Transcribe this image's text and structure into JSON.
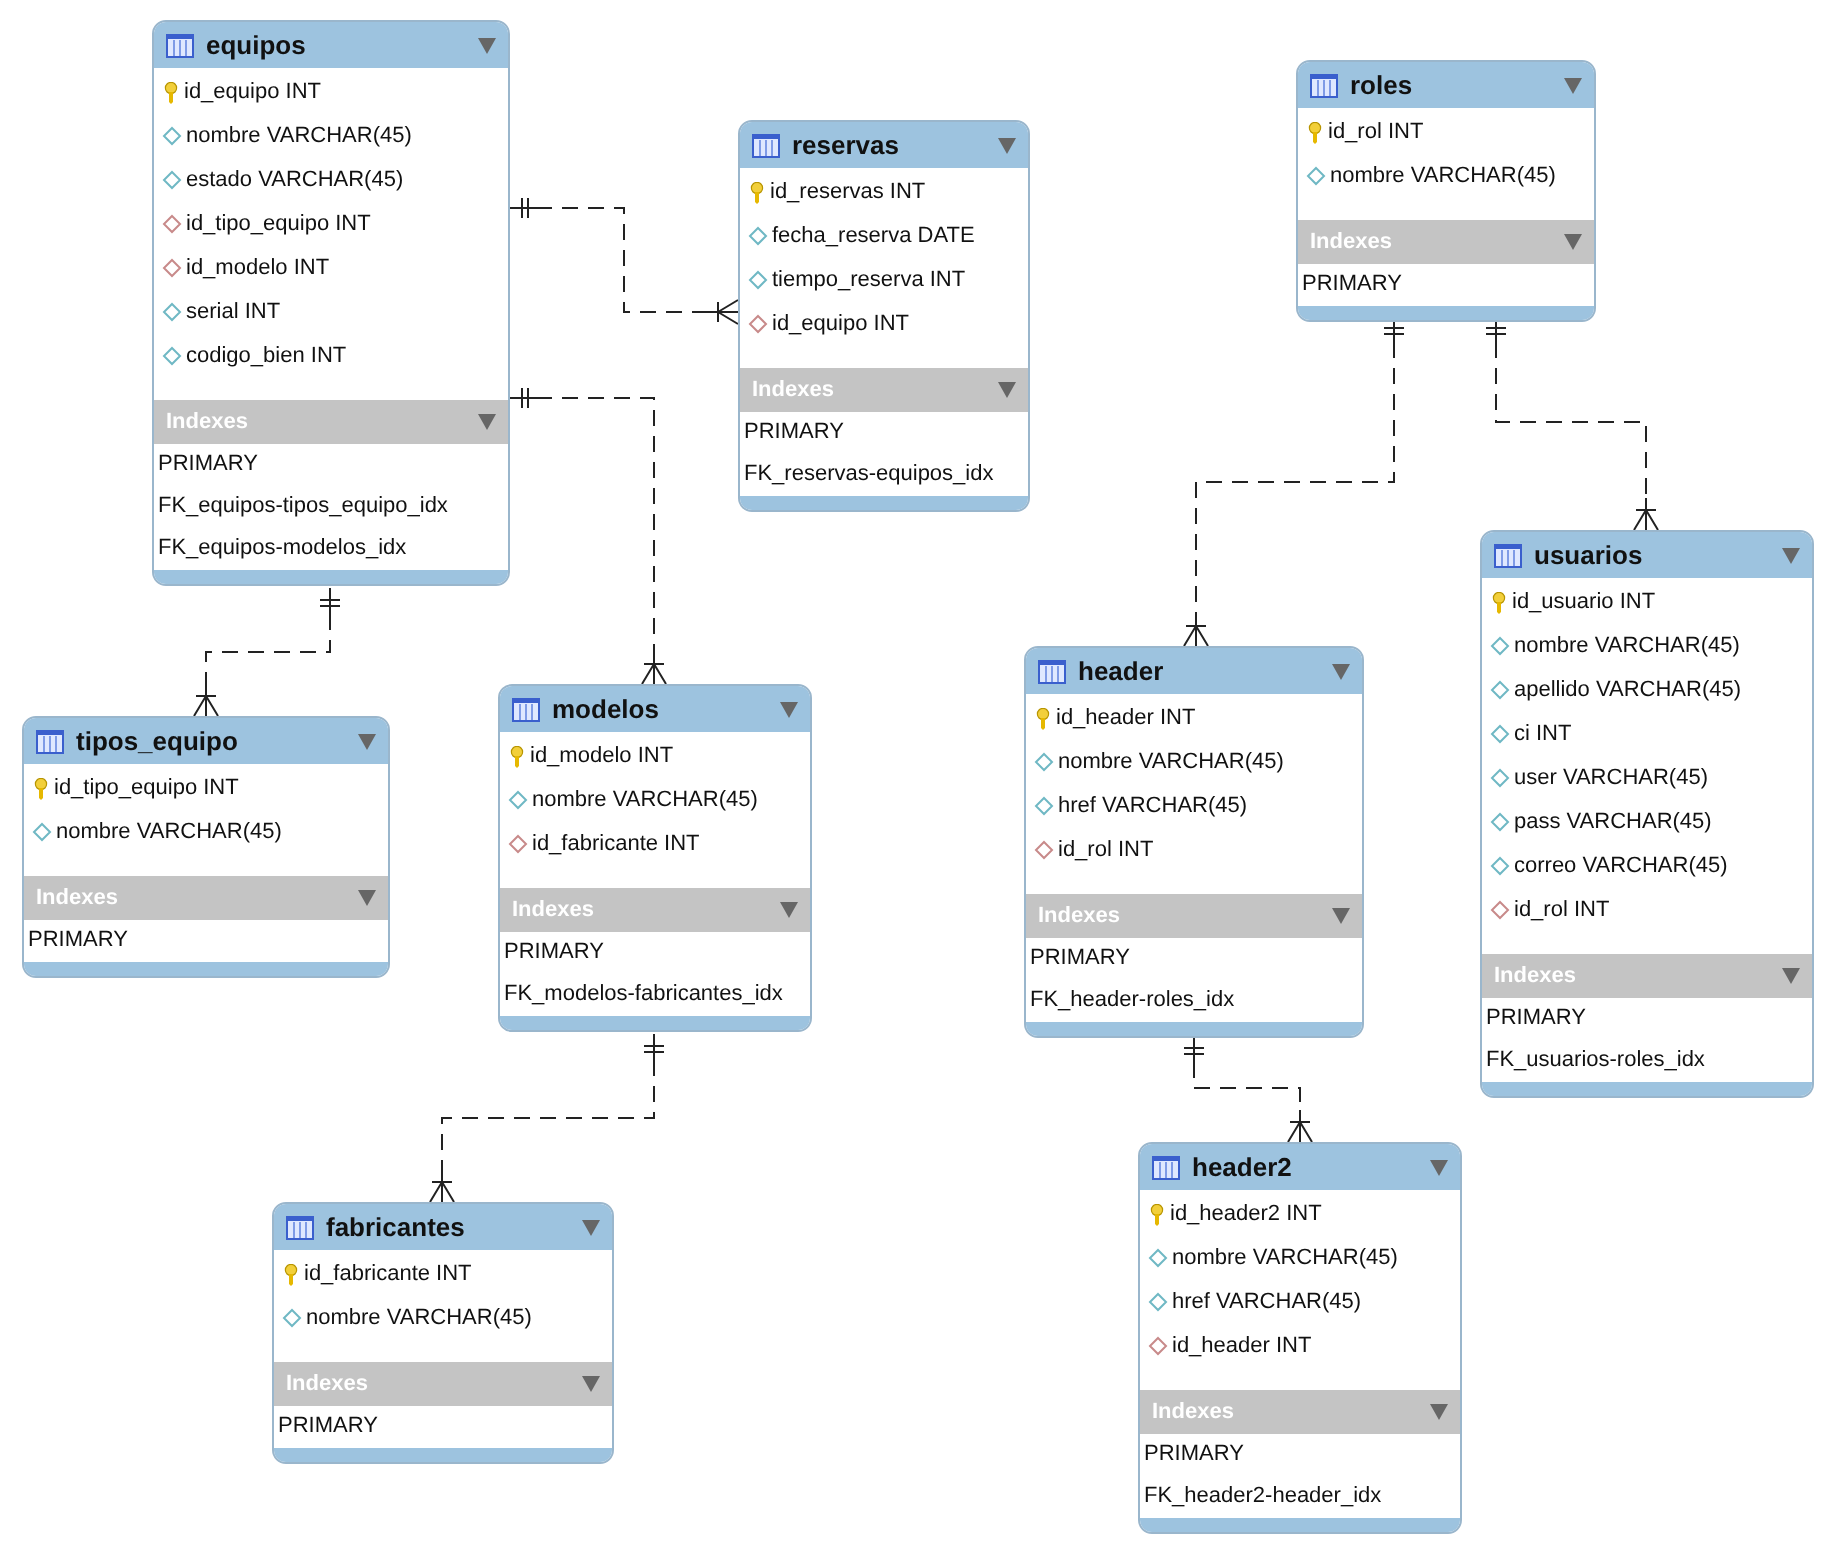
{
  "tables": [
    {
      "name": "equipos",
      "columns": [
        {
          "text": "id_equipo INT",
          "kind": "pk"
        },
        {
          "text": "nombre VARCHAR(45)",
          "kind": "column"
        },
        {
          "text": "estado VARCHAR(45)",
          "kind": "column"
        },
        {
          "text": "id_tipo_equipo INT",
          "kind": "fk"
        },
        {
          "text": "id_modelo INT",
          "kind": "fk"
        },
        {
          "text": "serial INT",
          "kind": "column"
        },
        {
          "text": "codigo_bien INT",
          "kind": "column"
        }
      ],
      "indexes_label": "Indexes",
      "indexes": [
        "PRIMARY",
        "FK_equipos-tipos_equipo_idx",
        "FK_equipos-modelos_idx"
      ]
    },
    {
      "name": "reservas",
      "columns": [
        {
          "text": "id_reservas INT",
          "kind": "pk"
        },
        {
          "text": "fecha_reserva DATE",
          "kind": "column"
        },
        {
          "text": "tiempo_reserva INT",
          "kind": "column"
        },
        {
          "text": "id_equipo INT",
          "kind": "fk"
        }
      ],
      "indexes_label": "Indexes",
      "indexes": [
        "PRIMARY",
        "FK_reservas-equipos_idx"
      ]
    },
    {
      "name": "roles",
      "columns": [
        {
          "text": "id_rol INT",
          "kind": "pk"
        },
        {
          "text": "nombre VARCHAR(45)",
          "kind": "column"
        }
      ],
      "indexes_label": "Indexes",
      "indexes": [
        "PRIMARY"
      ]
    },
    {
      "name": "usuarios",
      "columns": [
        {
          "text": "id_usuario INT",
          "kind": "pk"
        },
        {
          "text": "nombre VARCHAR(45)",
          "kind": "column"
        },
        {
          "text": "apellido VARCHAR(45)",
          "kind": "column"
        },
        {
          "text": "ci INT",
          "kind": "column"
        },
        {
          "text": "user VARCHAR(45)",
          "kind": "column"
        },
        {
          "text": "pass VARCHAR(45)",
          "kind": "column"
        },
        {
          "text": "correo VARCHAR(45)",
          "kind": "column"
        },
        {
          "text": "id_rol INT",
          "kind": "fk"
        }
      ],
      "indexes_label": "Indexes",
      "indexes": [
        "PRIMARY",
        "FK_usuarios-roles_idx"
      ]
    },
    {
      "name": "tipos_equipo",
      "columns": [
        {
          "text": "id_tipo_equipo INT",
          "kind": "pk"
        },
        {
          "text": "nombre VARCHAR(45)",
          "kind": "column"
        }
      ],
      "indexes_label": "Indexes",
      "indexes": [
        "PRIMARY"
      ]
    },
    {
      "name": "modelos",
      "columns": [
        {
          "text": "id_modelo INT",
          "kind": "pk"
        },
        {
          "text": "nombre VARCHAR(45)",
          "kind": "column"
        },
        {
          "text": "id_fabricante INT",
          "kind": "fk"
        }
      ],
      "indexes_label": "Indexes",
      "indexes": [
        "PRIMARY",
        "FK_modelos-fabricantes_idx"
      ]
    },
    {
      "name": "header",
      "columns": [
        {
          "text": "id_header INT",
          "kind": "pk"
        },
        {
          "text": "nombre VARCHAR(45)",
          "kind": "column"
        },
        {
          "text": "href VARCHAR(45)",
          "kind": "column"
        },
        {
          "text": "id_rol INT",
          "kind": "fk"
        }
      ],
      "indexes_label": "Indexes",
      "indexes": [
        "PRIMARY",
        "FK_header-roles_idx"
      ]
    },
    {
      "name": "fabricantes",
      "columns": [
        {
          "text": "id_fabricante INT",
          "kind": "pk"
        },
        {
          "text": "nombre VARCHAR(45)",
          "kind": "column"
        }
      ],
      "indexes_label": "Indexes",
      "indexes": [
        "PRIMARY"
      ]
    },
    {
      "name": "header2",
      "columns": [
        {
          "text": "id_header2 INT",
          "kind": "pk"
        },
        {
          "text": "nombre VARCHAR(45)",
          "kind": "column"
        },
        {
          "text": "href VARCHAR(45)",
          "kind": "column"
        },
        {
          "text": "id_header INT",
          "kind": "fk"
        }
      ],
      "indexes_label": "Indexes",
      "indexes": [
        "PRIMARY",
        "FK_header2-header_idx"
      ]
    }
  ]
}
